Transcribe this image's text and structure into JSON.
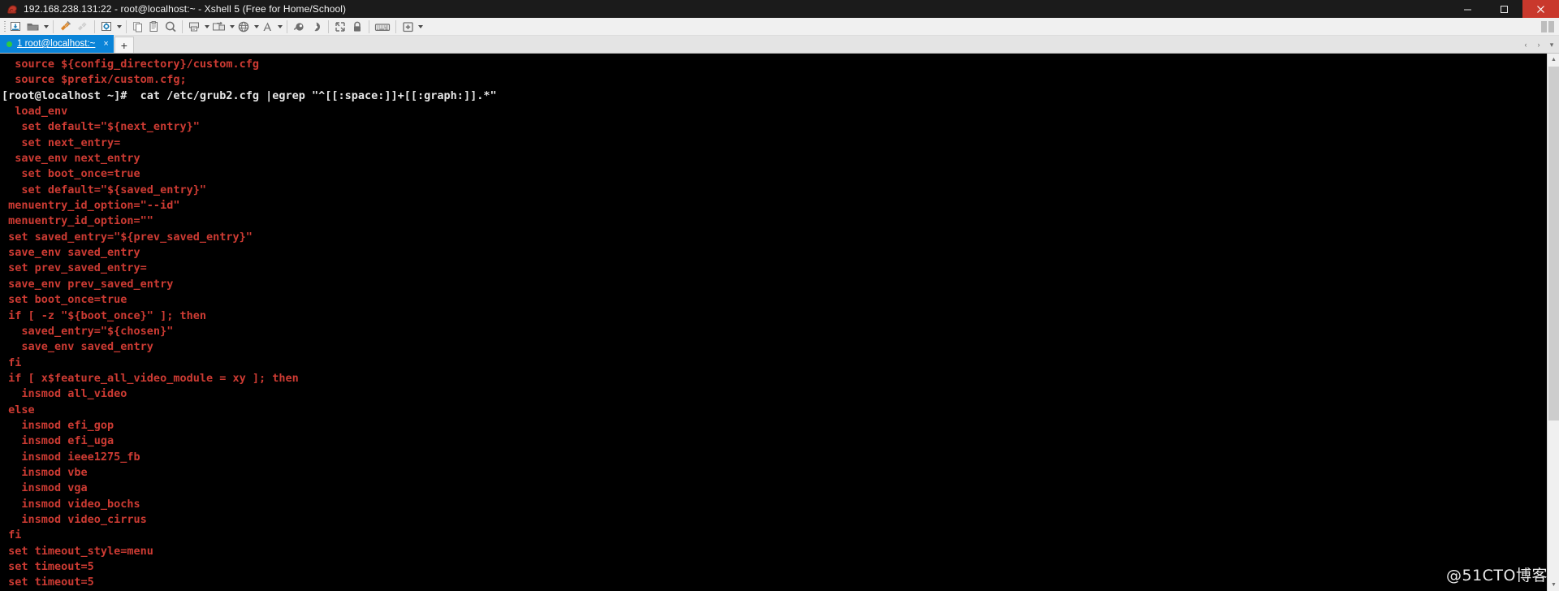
{
  "window": {
    "title": "192.168.238.131:22 - root@localhost:~ - Xshell 5 (Free for Home/School)",
    "app_icon": "xshell-shell-icon",
    "controls": {
      "minimize_label": "—",
      "maximize_label": "□",
      "close_label": "✕"
    },
    "close_color": "#c9382c",
    "titlebar_color": "#1b1b1b"
  },
  "toolbar": {
    "groups": [
      {
        "items": [
          {
            "name": "new-session-icon",
            "caret": false
          },
          {
            "name": "open-folder-icon",
            "caret": true
          }
        ]
      },
      {
        "items": [
          {
            "name": "connect-plug-icon",
            "caret": false
          },
          {
            "name": "disconnect-plug-icon",
            "caret": false
          }
        ]
      },
      {
        "items": [
          {
            "name": "properties-gear-icon",
            "caret": true
          }
        ]
      },
      {
        "items": [
          {
            "name": "copy-icon",
            "caret": false
          },
          {
            "name": "paste-icon",
            "caret": false
          },
          {
            "name": "find-icon",
            "caret": false
          }
        ]
      },
      {
        "items": [
          {
            "name": "log-to-file-icon",
            "caret": true
          },
          {
            "name": "file-transfer-icon",
            "caret": true
          },
          {
            "name": "web-browser-icon",
            "caret": true
          },
          {
            "name": "fonts-icon",
            "caret": true
          }
        ]
      },
      {
        "items": [
          {
            "name": "compose-bar-icon",
            "caret": false
          },
          {
            "name": "highlight-icon",
            "caret": false
          }
        ]
      },
      {
        "items": [
          {
            "name": "full-screen-icon",
            "caret": false
          },
          {
            "name": "lock-icon",
            "caret": false
          }
        ]
      },
      {
        "items": [
          {
            "name": "keyboard-icon",
            "caret": false
          }
        ]
      },
      {
        "items": [
          {
            "name": "add-icon",
            "caret": true
          }
        ]
      }
    ]
  },
  "tabs": {
    "items": [
      {
        "index_label": "1",
        "label": "1 root@localhost:~",
        "status_color": "#2ecb3f",
        "close_label": "×",
        "active": true
      }
    ],
    "new_tab_label": "+",
    "scroll_left_label": "‹",
    "scroll_right_label": "›",
    "menu_label": "▾",
    "active_color": "#0a84d8"
  },
  "terminal": {
    "fg_color": "#cd3b33",
    "prompt_color": "#e6e6e6",
    "bg_color": "#000000",
    "lines": [
      {
        "text": "  source ${config_directory}/custom.cfg",
        "kind": "match"
      },
      {
        "text": "  source $prefix/custom.cfg;",
        "kind": "match"
      },
      {
        "text": "[root@localhost ~]#  cat /etc/grub2.cfg |egrep \"^[[:space:]]+[[:graph:]].*\"",
        "kind": "prompt"
      },
      {
        "text": "  load_env",
        "kind": "match"
      },
      {
        "text": "   set default=\"${next_entry}\"",
        "kind": "match"
      },
      {
        "text": "   set next_entry=",
        "kind": "match"
      },
      {
        "text": "  save_env next_entry",
        "kind": "match"
      },
      {
        "text": "   set boot_once=true",
        "kind": "match"
      },
      {
        "text": "   set default=\"${saved_entry}\"",
        "kind": "match"
      },
      {
        "text": " menuentry_id_option=\"--id\"",
        "kind": "match"
      },
      {
        "text": " menuentry_id_option=\"\"",
        "kind": "match"
      },
      {
        "text": " set saved_entry=\"${prev_saved_entry}\"",
        "kind": "match"
      },
      {
        "text": " save_env saved_entry",
        "kind": "match"
      },
      {
        "text": " set prev_saved_entry=",
        "kind": "match"
      },
      {
        "text": " save_env prev_saved_entry",
        "kind": "match"
      },
      {
        "text": " set boot_once=true",
        "kind": "match"
      },
      {
        "text": " if [ -z \"${boot_once}\" ]; then",
        "kind": "match"
      },
      {
        "text": "   saved_entry=\"${chosen}\"",
        "kind": "match"
      },
      {
        "text": "   save_env saved_entry",
        "kind": "match"
      },
      {
        "text": " fi",
        "kind": "match"
      },
      {
        "text": " if [ x$feature_all_video_module = xy ]; then",
        "kind": "match"
      },
      {
        "text": "   insmod all_video",
        "kind": "match"
      },
      {
        "text": " else",
        "kind": "match"
      },
      {
        "text": "   insmod efi_gop",
        "kind": "match"
      },
      {
        "text": "   insmod efi_uga",
        "kind": "match"
      },
      {
        "text": "   insmod ieee1275_fb",
        "kind": "match"
      },
      {
        "text": "   insmod vbe",
        "kind": "match"
      },
      {
        "text": "   insmod vga",
        "kind": "match"
      },
      {
        "text": "   insmod video_bochs",
        "kind": "match"
      },
      {
        "text": "   insmod video_cirrus",
        "kind": "match"
      },
      {
        "text": " fi",
        "kind": "match"
      },
      {
        "text": " set timeout_style=menu",
        "kind": "match"
      },
      {
        "text": " set timeout=5",
        "kind": "match"
      },
      {
        "text": " set timeout=5",
        "kind": "match"
      }
    ]
  },
  "scrollbar": {
    "up_label": "▲",
    "down_label": "▼"
  },
  "watermark": {
    "text": "@51CTO博客"
  }
}
